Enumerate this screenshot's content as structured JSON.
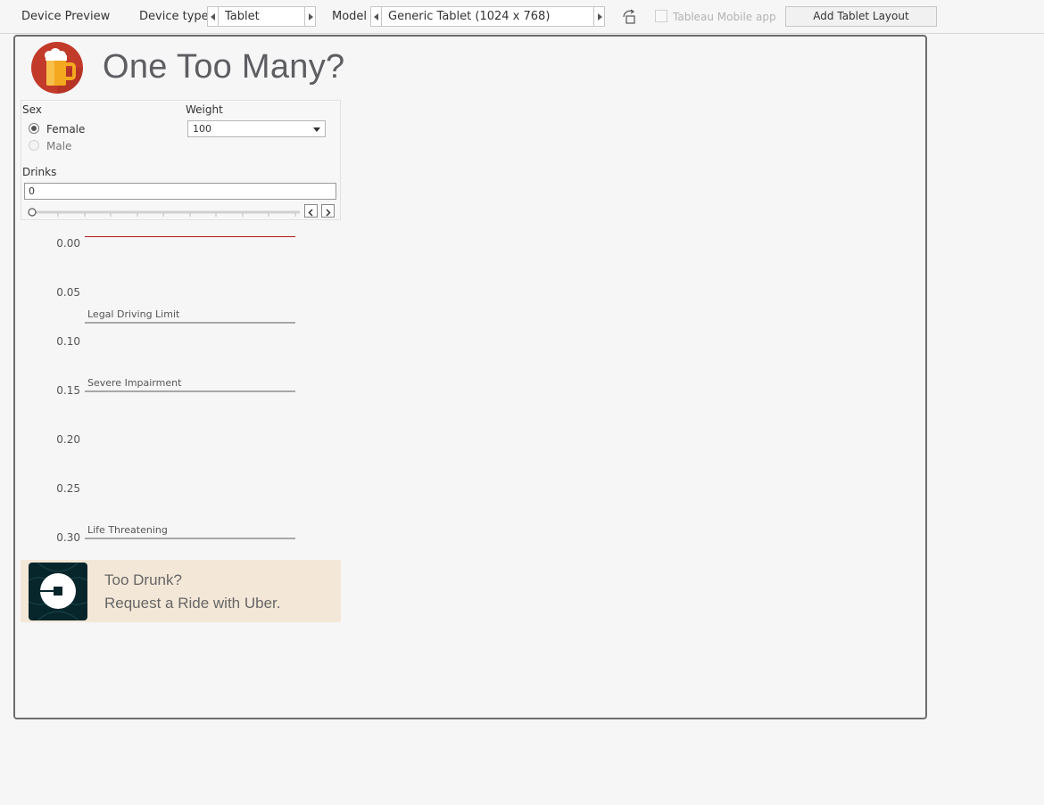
{
  "toolbar": {
    "preview_label": "Device Preview",
    "device_type_label": "Device type",
    "device_type_value": "Tablet",
    "model_label": "Model",
    "model_value": "Generic Tablet (1024 x 768)",
    "mobile_app_label": "Tableau Mobile app",
    "mobile_app_checked": false,
    "add_layout_button": "Add Tablet Layout"
  },
  "dashboard": {
    "title": "One Too Many?",
    "filters": {
      "sex_label": "Sex",
      "sex_options": [
        "Female",
        "Male"
      ],
      "sex_selected": "Female",
      "weight_label": "Weight",
      "weight_value": "100",
      "drinks_label": "Drinks",
      "drinks_value": "0",
      "drinks_slider_position": 0
    },
    "uber_banner": {
      "line1": "Too Drunk?",
      "line2": "Request a Ride with Uber."
    }
  },
  "chart_data": {
    "type": "bar",
    "orientation": "horizontal",
    "yticks": [
      "0.00",
      "0.05",
      "0.10",
      "0.15",
      "0.20",
      "0.25",
      "0.30"
    ],
    "ylim": [
      0,
      0.3
    ],
    "y_reversed": true,
    "values": [
      0.0
    ],
    "series_color": "#b31b1b",
    "reference_lines": [
      {
        "label": "Legal Driving Limit",
        "value": 0.08
      },
      {
        "label": "Severe Impairment",
        "value": 0.15
      },
      {
        "label": "Life Threatening",
        "value": 0.3
      }
    ],
    "grid": false
  }
}
